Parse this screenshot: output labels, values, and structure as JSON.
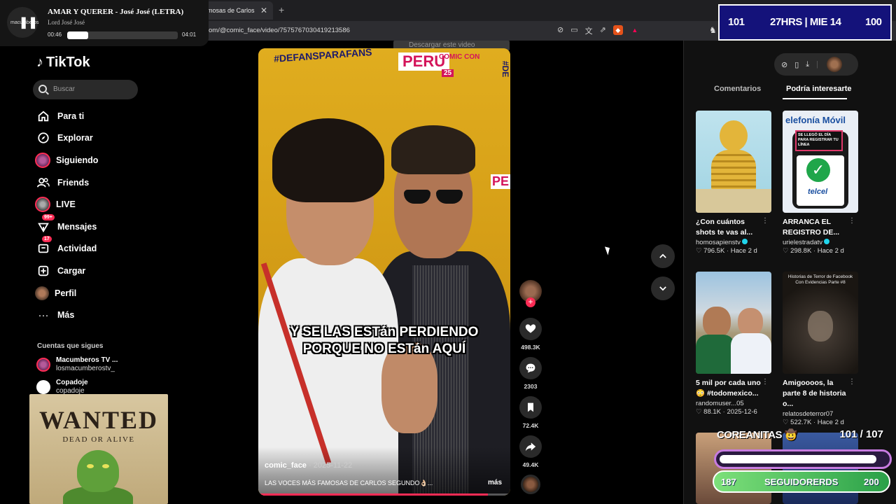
{
  "browser": {
    "tab_title": "mosas de Carlos",
    "url": "om/@comic_face/video/7575767030419213586",
    "download_hint": "Descargar este video"
  },
  "music": {
    "logo_text": "macumberos",
    "title": "AMAR Y QUERER - José José (LETRA)",
    "artist": "Lord José José",
    "elapsed": "00:46",
    "duration": "04:01",
    "progress": 0.19
  },
  "tiktok": {
    "logo": "TikTok",
    "search_placeholder": "Buscar",
    "nav": [
      {
        "label": "Para ti",
        "icon": "home-icon"
      },
      {
        "label": "Explorar",
        "icon": "compass-icon"
      },
      {
        "label": "Siguiendo",
        "icon": "following-avatar"
      },
      {
        "label": "Friends",
        "icon": "friends-icon"
      },
      {
        "label": "LIVE",
        "icon": "live-avatar"
      },
      {
        "label": "Mensajes",
        "icon": "messages-icon",
        "badge": "99+"
      },
      {
        "label": "Actividad",
        "icon": "activity-icon",
        "badge": "17"
      },
      {
        "label": "Cargar",
        "icon": "upload-icon"
      },
      {
        "label": "Perfil",
        "icon": "profile-avatar"
      },
      {
        "label": "Más",
        "icon": "more-icon"
      }
    ],
    "following_title": "Cuentas que sigues",
    "following": [
      {
        "name": "Macumberos TV ...",
        "handle": "losmacumberostv_"
      },
      {
        "name": "Copadoje",
        "handle": "copadoje"
      }
    ]
  },
  "wanted": {
    "title": "WANTED",
    "subtitle": "DEAD OR ALIVE"
  },
  "video": {
    "hashtag": "#DEFANSPARAFANS",
    "banner_brand": "PERU",
    "banner_comic": "COMIC CON",
    "banner_year": "25",
    "side_text": "#DE",
    "side_pe": "PE",
    "caption_line1": "Y SE LAS ESTán PERDIENDO",
    "caption_line2": "PORQUE NO ESTán AQUÍ",
    "author": "comic_face",
    "date": "2025-11-22",
    "description": "LAS VOCES MÁS FAMOSAS DE CARLOS SEGUNDO👌🏻...",
    "more_label": "más",
    "progress": 0.91
  },
  "actions": {
    "likes": "498.3K",
    "comments": "2303",
    "saves": "72.4K",
    "shares": "49.4K"
  },
  "right": {
    "tab_comments": "Comentarios",
    "tab_suggested": "Podría interesarte",
    "tiles": [
      {
        "title": "¿Con cuántos shots te vas al...",
        "user": "homosapienstv",
        "verified": true,
        "likes": "796.5K",
        "date": "Hace 2 d",
        "thumb": "skeleton"
      },
      {
        "title": "ARRANCA EL REGISTRO DE...",
        "user": "urielestradatv",
        "verified": true,
        "likes": "298.8K",
        "date": "Hace 2 d",
        "thumb": "telcel",
        "thumb_text": "SE LLEGÓ EL DÍA PARA REGISTRAR TU LÍNEA",
        "thumb_brand": "telcel",
        "thumb_header": "elefonía Móvil"
      },
      {
        "title": "5 mil por cada uno 😳 #todomexico...",
        "user": "randomuser...05",
        "verified": false,
        "likes": "88.1K",
        "date": "2025-12-6",
        "thumb": "soccer"
      },
      {
        "title": "Amigoooos, la parte 8 de historia o...",
        "user": "relatosdeterror07",
        "verified": false,
        "likes": "522.7K",
        "date": "Hace 2 d",
        "thumb": "horror",
        "thumb_text": "Historias de Terror de Facebook Con Evidencias Parte #8"
      }
    ]
  },
  "overlay": {
    "left_num": "101",
    "center": "27HRS | MIE 14",
    "right_num": "100",
    "goal_name": "COREANITAS 🤠",
    "goal_count": "101  / 107",
    "goal_progress": 0.94,
    "followers_left": "187",
    "followers_label": "SEGUIDORERDS",
    "followers_right": "200"
  }
}
